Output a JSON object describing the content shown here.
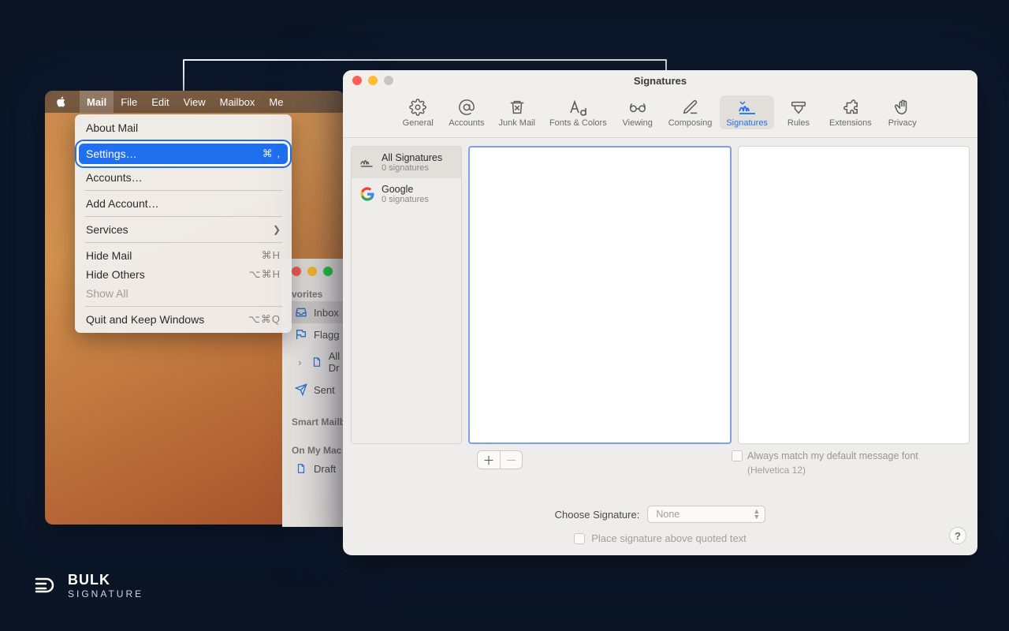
{
  "menubar": {
    "items": [
      "Mail",
      "File",
      "Edit",
      "View",
      "Mailbox",
      "Me"
    ]
  },
  "dropdown": {
    "about": "About Mail",
    "settings": "Settings…",
    "settings_shortcut": "⌘ ,",
    "accounts": "Accounts…",
    "add_account": "Add Account…",
    "services": "Services",
    "hide_mail": "Hide Mail",
    "hide_mail_sc": "⌘H",
    "hide_others": "Hide Others",
    "hide_others_sc": "⌥⌘H",
    "show_all": "Show All",
    "quit": "Quit and Keep Windows",
    "quit_sc": "⌥⌘Q"
  },
  "mail_sidebar": {
    "favorites": "vorites",
    "inbox": "Inbox",
    "flagged": "Flagg",
    "all_drafts": "All Dr",
    "sent": "Sent",
    "smart": "Smart Mailb",
    "onmymac": "On My Mac",
    "drafts": "Draft"
  },
  "prefs": {
    "title": "Signatures",
    "toolbar": {
      "general": "General",
      "accounts": "Accounts",
      "junk": "Junk Mail",
      "fonts": "Fonts & Colors",
      "viewing": "Viewing",
      "composing": "Composing",
      "signatures": "Signatures",
      "rules": "Rules",
      "extensions": "Extensions",
      "privacy": "Privacy"
    },
    "accounts": [
      {
        "name": "All Signatures",
        "sub": "0 signatures"
      },
      {
        "name": "Google",
        "sub": "0 signatures"
      }
    ],
    "always_match": "Always match my default message font",
    "helvetica": "(Helvetica 12)",
    "choose_label": "Choose Signature:",
    "choose_value": "None",
    "place_above": "Place signature above quoted text",
    "help": "?"
  },
  "brand": {
    "line1": "BULK",
    "line2": "SIGNATURE"
  }
}
